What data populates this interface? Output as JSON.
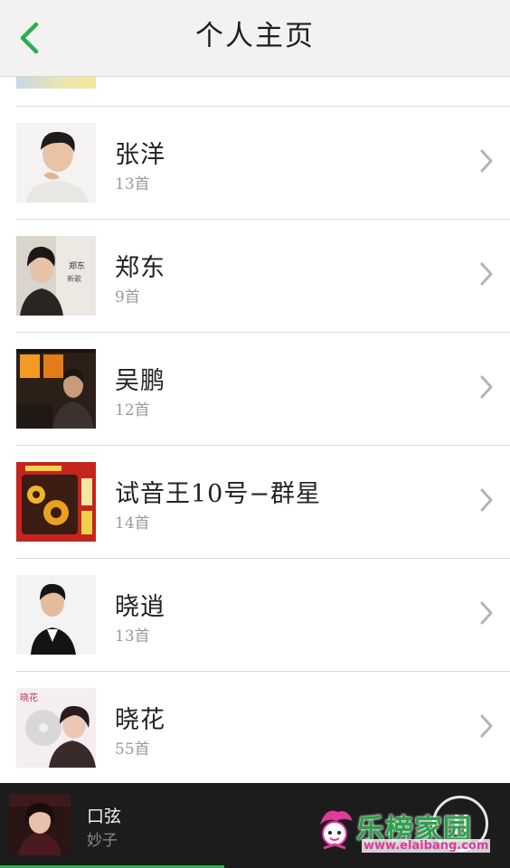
{
  "header": {
    "title": "个人主页",
    "back_icon": "chevron-left-icon",
    "accent": "#2cae4f"
  },
  "artists": [
    {
      "name": "张洋",
      "count": "13首"
    },
    {
      "name": "郑东",
      "count": "9首"
    },
    {
      "name": "吴鹏",
      "count": "12首"
    },
    {
      "name": "试音王10号−群星",
      "count": "14首"
    },
    {
      "name": "晓逍",
      "count": "13首"
    },
    {
      "name": "晓花",
      "count": "55首"
    }
  ],
  "player": {
    "title": "口弦",
    "artist": "妙子",
    "progress": 0.44,
    "control_icon": "pause-icon"
  },
  "watermark": {
    "text": "乐榜家园",
    "url": "www.elaibang.com"
  }
}
